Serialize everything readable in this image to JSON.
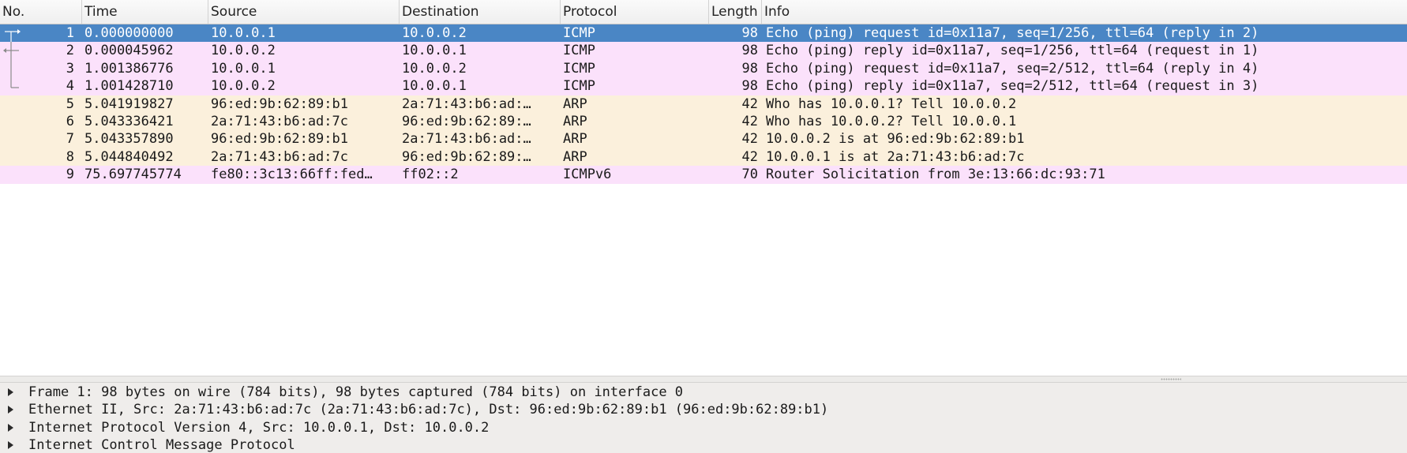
{
  "packet_list": {
    "columns": [
      "No.",
      "Time",
      "Source",
      "Destination",
      "Protocol",
      "Length",
      "Info"
    ],
    "row_colors": {
      "selected_bg": "#4a86c5",
      "icmp_bg": "#fbe1fb",
      "arp_bg": "#fbf0dc",
      "icmpv6_bg": "#fbe1fb"
    },
    "rows": [
      {
        "no": "1",
        "time": "0.000000000",
        "source": "10.0.0.1",
        "destination": "10.0.0.2",
        "protocol": "ICMP",
        "length": "98",
        "info": "Echo (ping) request  id=0x11a7, seq=1/256, ttl=64 (reply in 2)",
        "kind": "icmp",
        "selected": true,
        "marker": "request"
      },
      {
        "no": "2",
        "time": "0.000045962",
        "source": "10.0.0.2",
        "destination": "10.0.0.1",
        "protocol": "ICMP",
        "length": "98",
        "info": "Echo (ping) reply    id=0x11a7, seq=1/256, ttl=64 (request in 1)",
        "kind": "icmp",
        "selected": false,
        "marker": "reply"
      },
      {
        "no": "3",
        "time": "1.001386776",
        "source": "10.0.0.1",
        "destination": "10.0.0.2",
        "protocol": "ICMP",
        "length": "98",
        "info": "Echo (ping) request  id=0x11a7, seq=2/512, ttl=64 (reply in 4)",
        "kind": "icmp",
        "selected": false,
        "marker": "line"
      },
      {
        "no": "4",
        "time": "1.001428710",
        "source": "10.0.0.2",
        "destination": "10.0.0.1",
        "protocol": "ICMP",
        "length": "98",
        "info": "Echo (ping) reply    id=0x11a7, seq=2/512, ttl=64 (request in 3)",
        "kind": "icmp",
        "selected": false,
        "marker": "end"
      },
      {
        "no": "5",
        "time": "5.041919827",
        "source": "96:ed:9b:62:89:b1",
        "destination": "2a:71:43:b6:ad:…",
        "protocol": "ARP",
        "length": "42",
        "info": "Who has 10.0.0.1? Tell 10.0.0.2",
        "kind": "arp",
        "selected": false,
        "marker": ""
      },
      {
        "no": "6",
        "time": "5.043336421",
        "source": "2a:71:43:b6:ad:7c",
        "destination": "96:ed:9b:62:89:…",
        "protocol": "ARP",
        "length": "42",
        "info": "Who has 10.0.0.2? Tell 10.0.0.1",
        "kind": "arp",
        "selected": false,
        "marker": ""
      },
      {
        "no": "7",
        "time": "5.043357890",
        "source": "96:ed:9b:62:89:b1",
        "destination": "2a:71:43:b6:ad:…",
        "protocol": "ARP",
        "length": "42",
        "info": "10.0.0.2 is at 96:ed:9b:62:89:b1",
        "kind": "arp",
        "selected": false,
        "marker": ""
      },
      {
        "no": "8",
        "time": "5.044840492",
        "source": "2a:71:43:b6:ad:7c",
        "destination": "96:ed:9b:62:89:…",
        "protocol": "ARP",
        "length": "42",
        "info": "10.0.0.1 is at 2a:71:43:b6:ad:7c",
        "kind": "arp",
        "selected": false,
        "marker": ""
      },
      {
        "no": "9",
        "time": "75.697745774",
        "source": "fe80::3c13:66ff:fed…",
        "destination": "ff02::2",
        "protocol": "ICMPv6",
        "length": "70",
        "info": "Router Solicitation from 3e:13:66:dc:93:71",
        "kind": "icmpv6",
        "selected": false,
        "marker": ""
      }
    ]
  },
  "packet_details": {
    "items": [
      {
        "label": "Frame 1: 98 bytes on wire (784 bits), 98 bytes captured (784 bits) on interface 0",
        "expanded": false
      },
      {
        "label": "Ethernet II, Src: 2a:71:43:b6:ad:7c (2a:71:43:b6:ad:7c), Dst: 96:ed:9b:62:89:b1 (96:ed:9b:62:89:b1)",
        "expanded": false
      },
      {
        "label": "Internet Protocol Version 4, Src: 10.0.0.1, Dst: 10.0.0.2",
        "expanded": false
      },
      {
        "label": "Internet Control Message Protocol",
        "expanded": false
      }
    ]
  },
  "icons": {
    "expand": "expand-arrow-icon",
    "conversation_request": "related-request-icon",
    "conversation_reply": "related-reply-icon"
  }
}
